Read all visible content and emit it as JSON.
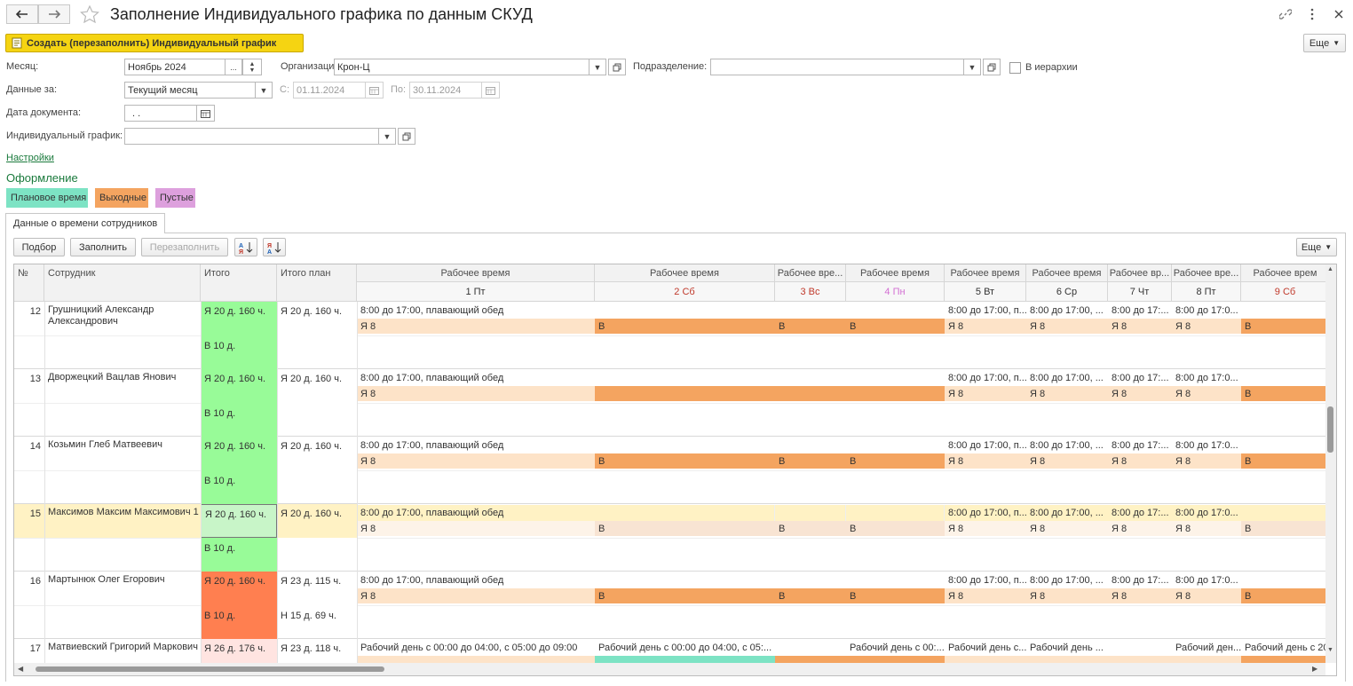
{
  "window": {
    "title": "Заполнение Индивидуального графика по данным СКУД",
    "back_icon": "arrow-left-icon",
    "forward_icon": "arrow-right-icon",
    "star_icon": "star-icon",
    "link_icon": "link-icon",
    "more_icon": "more-vertical-icon",
    "close_icon": "close-icon"
  },
  "toolbar": {
    "create_label": "Создать (перезаполнить) Индивидуальный график",
    "more_label": "Еще"
  },
  "form": {
    "month_label": "Месяц:",
    "month_value": "Ноябрь 2024",
    "month_ellipsis": "...",
    "org_label": "Организация:",
    "org_value": "Крон-Ц",
    "dept_label": "Подразделение:",
    "dept_value": "",
    "hierarchy_label": "В иерархии",
    "hierarchy_checked": false,
    "data_for_label": "Данные за:",
    "data_for_value": "Текущий месяц",
    "from_label": "С:",
    "from_value": "01.11.2024",
    "to_label": "По:",
    "to_value": "30.11.2024",
    "doc_date_label": "Дата документа:",
    "doc_date_value": " .  .",
    "schedule_label": "Индивидуальный график:",
    "schedule_value": "",
    "settings_link": "Настройки"
  },
  "design": {
    "heading": "Оформление",
    "legend": [
      {
        "label": "Плановое время",
        "color": "#7de3c4"
      },
      {
        "label": "Выходные",
        "color": "#f4a460"
      },
      {
        "label": "Пустые",
        "color": "#dda0dd"
      }
    ]
  },
  "tab": {
    "label": "Данные о времени сотрудников"
  },
  "grid_toolbar": {
    "pick_label": "Подбор",
    "fill_label": "Заполнить",
    "refill_label": "Перезаполнить",
    "sort_asc_icon": "sort-ascending-icon",
    "sort_desc_icon": "sort-descending-icon",
    "more_label": "Еще"
  },
  "colors": {
    "weekend_header": "#c0392b",
    "empty_header": "#d36fd3",
    "green": "#98fb98",
    "red": "#ff7f50",
    "pink": "#ffe4e1",
    "light_orange": "#fde3c8",
    "dark_orange": "#f4a460",
    "selected_row": "#fff2c4",
    "cyan": "#7de3c4"
  },
  "table": {
    "headers": {
      "num": "№",
      "employee": "Сотрудник",
      "total": "Итого",
      "total_plan": "Итого план"
    },
    "days": [
      {
        "group": "Рабочее время",
        "label": "1 Пт",
        "type": "work"
      },
      {
        "group": "Рабочее время",
        "label": "2 Сб",
        "type": "weekend"
      },
      {
        "group": "Рабочее вре...",
        "label": "3 Вс",
        "type": "weekend"
      },
      {
        "group": "Рабочее время",
        "label": "4 Пн",
        "type": "empty"
      },
      {
        "group": "Рабочее время",
        "label": "5 Вт",
        "type": "work"
      },
      {
        "group": "Рабочее время",
        "label": "6 Ср",
        "type": "work"
      },
      {
        "group": "Рабочее вр...",
        "label": "7 Чт",
        "type": "work"
      },
      {
        "group": "Рабочее вре...",
        "label": "8 Пт",
        "type": "work"
      },
      {
        "group": "Рабочее врем",
        "label": "9 Сб",
        "type": "weekend"
      }
    ],
    "rows": [
      {
        "num": "12",
        "name": "Грушницкий Александр Александрович",
        "total1": "Я 20 д. 160 ч.",
        "total2": "В 10 д.",
        "plan1": "Я 20 д. 160 ч.",
        "plan2": "",
        "total1_color": "green",
        "total2_color": "green",
        "schedule": [
          "8:00 до 17:00, плавающий обед",
          "",
          "",
          "",
          "8:00 до 17:00, п...",
          "8:00 до 17:00, ...",
          "8:00 до 17:...",
          "8:00 до 17:0...",
          ""
        ],
        "codes": [
          "Я 8",
          "В",
          "В",
          "В",
          "Я 8",
          "Я 8",
          "Я 8",
          "Я 8",
          "В"
        ]
      },
      {
        "num": "13",
        "name": "Дворжецкий Вацлав Янович",
        "total1": "Я 20 д. 160 ч.",
        "total2": "В 10 д.",
        "plan1": "Я 20 д. 160 ч.",
        "plan2": "",
        "total1_color": "green",
        "total2_color": "green",
        "schedule": [
          "8:00 до 17:00, плавающий обед",
          "",
          "",
          "",
          "8:00 до 17:00, п...",
          "8:00 до 17:00, ...",
          "8:00 до 17:...",
          "8:00 до 17:0...",
          ""
        ],
        "codes": [
          "Я 8",
          "",
          "",
          "",
          "Я 8",
          "Я 8",
          "Я 8",
          "Я 8",
          "В"
        ]
      },
      {
        "num": "14",
        "name": "Козьмин Глеб Матвеевич",
        "total1": "Я 20 д. 160 ч.",
        "total2": "В 10 д.",
        "plan1": "Я 20 д. 160 ч.",
        "plan2": "",
        "total1_color": "green",
        "total2_color": "green",
        "schedule": [
          "8:00 до 17:00, плавающий обед",
          "",
          "",
          "",
          "8:00 до 17:00, п...",
          "8:00 до 17:00, ...",
          "8:00 до 17:...",
          "8:00 до 17:0...",
          ""
        ],
        "codes": [
          "Я 8",
          "В",
          "В",
          "В",
          "Я 8",
          "Я 8",
          "Я 8",
          "Я 8",
          "В"
        ]
      },
      {
        "num": "15",
        "name": "Максимов Максим Максимович 1",
        "total1": "Я 20 д. 160 ч.",
        "total2": "В 10 д.",
        "plan1": "Я 20 д. 160 ч.",
        "plan2": "",
        "total1_color": "green",
        "total2_color": "green",
        "selected": true,
        "schedule": [
          "8:00 до 17:00, плавающий обед",
          "",
          "",
          "",
          "8:00 до 17:00, п...",
          "8:00 до 17:00, ...",
          "8:00 до 17:...",
          "8:00 до 17:0...",
          ""
        ],
        "codes": [
          "Я 8",
          "В",
          "В",
          "В",
          "Я 8",
          "Я 8",
          "Я 8",
          "Я 8",
          "В"
        ]
      },
      {
        "num": "16",
        "name": "Мартынюк Олег Егорович",
        "total1": "Я 20 д. 160 ч.",
        "total2": "В 10 д.",
        "plan1": "Я 23 д. 115 ч.",
        "plan2": "Н 15 д. 69 ч.",
        "total1_color": "red",
        "total2_color": "red",
        "schedule": [
          "8:00 до 17:00, плавающий обед",
          "",
          "",
          "",
          "8:00 до 17:00, п...",
          "8:00 до 17:00, ...",
          "8:00 до 17:...",
          "8:00 до 17:0...",
          ""
        ],
        "codes": [
          "Я 8",
          "В",
          "В",
          "В",
          "Я 8",
          "Я 8",
          "Я 8",
          "Я 8",
          "В"
        ]
      },
      {
        "num": "17",
        "name": "Матвиевский Григорий Маркович",
        "total1": "Я 26 д. 176 ч.",
        "total2": "",
        "plan1": "Я 23 д. 118 ч.",
        "plan2": "",
        "total1_color": "pink",
        "total2_color": "pink",
        "schedule": [
          "Рабочий день с 00:00 до 04:00, с 05:00 до 09:00",
          "Рабочий день с 00:00 до 04:00, с 05:...",
          "",
          "Рабочий день с 00:...",
          "Рабочий день с...",
          "Рабочий день ...",
          "",
          "Рабочий ден...",
          "Рабочий день с 20..."
        ],
        "codes": [
          "",
          "",
          "",
          "",
          "",
          "",
          "",
          "",
          ""
        ]
      }
    ]
  }
}
